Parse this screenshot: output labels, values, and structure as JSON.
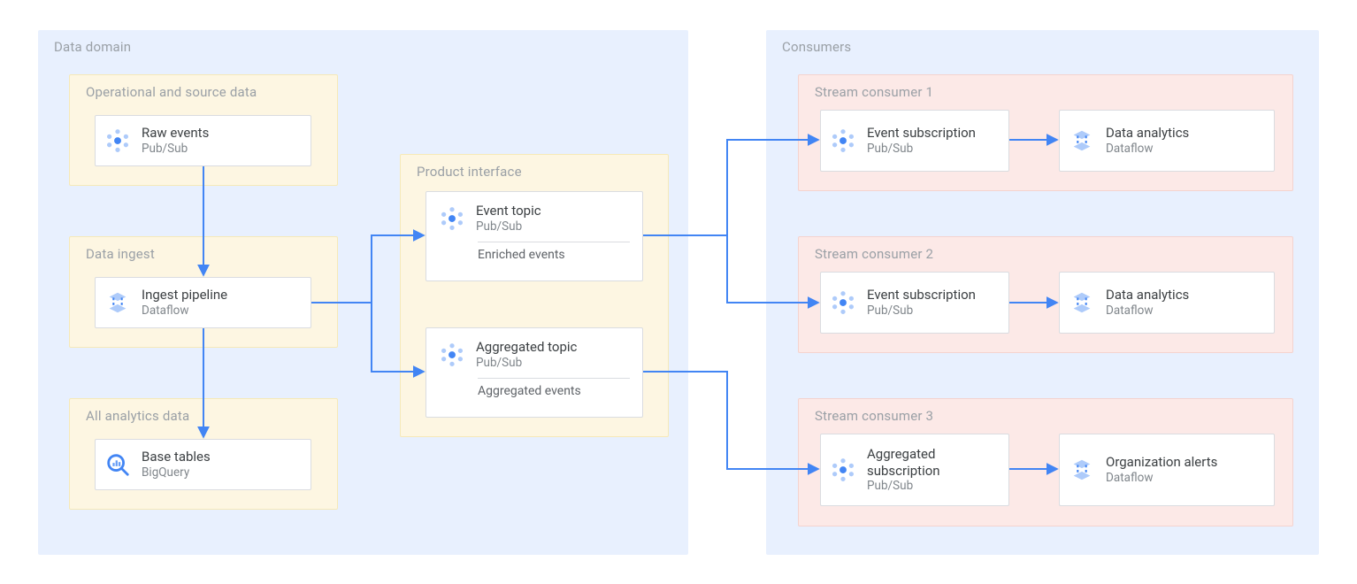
{
  "regions": {
    "data_domain": "Data domain",
    "consumers": "Consumers",
    "source_data": "Operational and source data",
    "data_ingest": "Data ingest",
    "all_analytics": "All analytics data",
    "product_interface": "Product interface",
    "stream1": "Stream consumer 1",
    "stream2": "Stream consumer 2",
    "stream3": "Stream consumer 3"
  },
  "services": {
    "raw_events": {
      "title": "Raw events",
      "sub": "Pub/Sub"
    },
    "ingest_pipeline": {
      "title": "Ingest pipeline",
      "sub": "Dataflow"
    },
    "base_tables": {
      "title": "Base tables",
      "sub": "BigQuery"
    },
    "event_topic": {
      "title": "Event topic",
      "sub": "Pub/Sub",
      "note": "Enriched events"
    },
    "agg_topic": {
      "title": "Aggregated topic",
      "sub": "Pub/Sub",
      "note": "Aggregated events"
    },
    "c1_sub": {
      "title": "Event subscription",
      "sub": "Pub/Sub"
    },
    "c1_out": {
      "title": "Data analytics",
      "sub": "Dataflow"
    },
    "c2_sub": {
      "title": "Event subscription",
      "sub": "Pub/Sub"
    },
    "c2_out": {
      "title": "Data analytics",
      "sub": "Dataflow"
    },
    "c3_sub": {
      "title": "Aggregated subscription",
      "sub": "Pub/Sub"
    },
    "c3_out": {
      "title": "Organization alerts",
      "sub": "Dataflow"
    }
  }
}
